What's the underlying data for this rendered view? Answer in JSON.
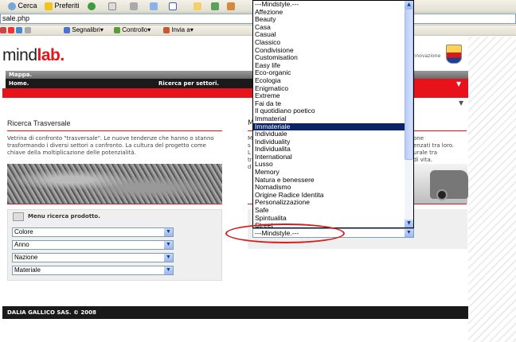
{
  "browser": {
    "toolbar": {
      "search": "Cerca",
      "favorites": "Preferiti"
    },
    "address_fragment": "sale.php",
    "links_bar": {
      "bookmarks": "Segnalibri",
      "control": "Controllo",
      "send": "Invia a"
    }
  },
  "site": {
    "logo_plain": "mind",
    "logo_red": "lab.",
    "innovation_fragment": "innovazione",
    "nav": {
      "map": "Mappa.",
      "home": "Home.",
      "sector_search": "Ricerca per settori."
    },
    "left_section": {
      "title": "Ricerca Trasversale",
      "description": "Vetrina di confronto \"trasversale\". Le nuove tendenze che hanno o stanno trasformando i diversi settori a confronto. La cultura del progetto come chiave della moltiplicazione delle potenzialità."
    },
    "product_search": {
      "heading": "Menu ricerca prodotto.",
      "selects": [
        "Colore",
        "Anno",
        "Nazione",
        "Materiale"
      ]
    },
    "right_fragments": {
      "title_frag": "M",
      "lines_right": [
        "one",
        "enzati tra loro.",
        "urale tra",
        "di vita."
      ],
      "lines_left": [
        "M",
        "s",
        "L",
        "tr",
        "d"
      ]
    },
    "footer": "DALIA GALLICO SAS. © 2008"
  },
  "mindstyle_dropdown": {
    "options": [
      "---Mindstyle.---",
      "Affezione",
      "Beauty",
      "Casa",
      "Casual",
      "Classico",
      "Condivisione",
      "Customisation",
      "Easy life",
      "Eco-organic",
      "Ecologia",
      "Enigmatico",
      "Extreme",
      "Fai da te",
      "Il quotidiano poetico",
      "Immaterial",
      "Immateriale",
      "Individuale",
      "Individuality",
      "Individualita",
      "International",
      "Lusso",
      "Memory",
      "Natura e benessere",
      "Nomadismo",
      "Origine Radice Identita",
      "Personalizzazione",
      "Safe",
      "Spintualita",
      "Street"
    ],
    "highlighted": "Immateriale",
    "selected_value": "---Mindstyle.---"
  },
  "colors": {
    "brand_red": "#e8121b",
    "nav_dark": "#1a1a1a",
    "highlight": "#0a246a",
    "annotation": "#d61c1c"
  }
}
